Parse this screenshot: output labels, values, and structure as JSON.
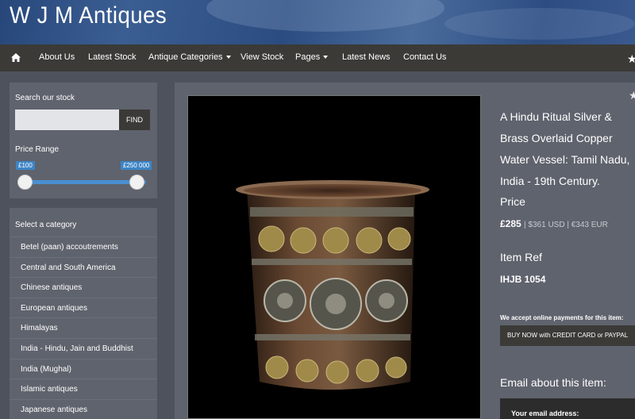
{
  "site": {
    "title": "W J M Antiques"
  },
  "nav": {
    "home_icon": "home-icon",
    "items": [
      {
        "label": "About Us"
      },
      {
        "label": "Latest Stock"
      },
      {
        "label": "Antique Categories",
        "dropdown": true
      },
      {
        "label": "View Stock"
      },
      {
        "label": "Pages",
        "dropdown": true
      },
      {
        "label": "Latest News"
      },
      {
        "label": "Contact Us"
      }
    ]
  },
  "search": {
    "title": "Search our stock",
    "input_value": "",
    "button_label": "FIND",
    "price_range_label": "Price Range",
    "min_label": "£100",
    "max_label": "£250 000"
  },
  "categories": {
    "title": "Select a category",
    "items": [
      "Betel (paan) accoutrements",
      "Central and South America",
      "Chinese antiques",
      "European antiques",
      "Himalayas",
      "India - Hindu, Jain and Buddhist",
      "India (Mughal)",
      "Islamic antiques",
      "Japanese antiques"
    ]
  },
  "product": {
    "title": "A Hindu Ritual Silver & Brass Overlaid Copper Water Vessel: Tamil Nadu, India - 19th Century.",
    "price_label": "Price",
    "price": "£285",
    "price_conversions": "| $361 USD | €343 EUR",
    "ref_label": "Item Ref",
    "ref": "IHJB 1054",
    "payment_note": "We accept online payments for this item:",
    "buy_button": "BUY NOW with CREDIT CARD or PAYPAL",
    "email_heading": "Email about this item:",
    "email_label": "Your email address:"
  },
  "colors": {
    "accent": "#3d85c6",
    "navbar": "#3b3a37",
    "panel": "#5f636d",
    "background": "#4e525c"
  }
}
